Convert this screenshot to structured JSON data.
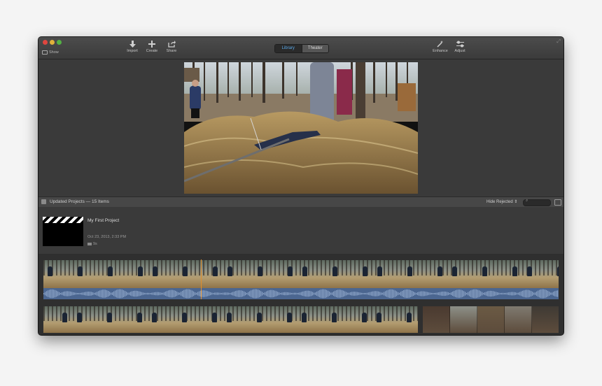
{
  "window": {
    "controls": [
      "close",
      "minimize",
      "zoom"
    ]
  },
  "toolbar": {
    "show_label": "Show",
    "import_label": "Import",
    "create_label": "Create",
    "share_label": "Share",
    "library_label": "Library",
    "theater_label": "Theater",
    "enhance_label": "Enhance",
    "adjust_label": "Adjust"
  },
  "browser": {
    "title": "Updated Projects — 15 Items",
    "hide_rejected_label": "Hide Rejected",
    "search_placeholder": ""
  },
  "project": {
    "name": "My First Project",
    "date": "Oct 23, 2013, 2:33 PM",
    "duration": "9s"
  },
  "icons": [
    "close-icon",
    "minimize-icon",
    "zoom-icon",
    "sidebar-icon",
    "import-arrow-icon",
    "create-plus-icon",
    "share-icon",
    "enhance-wand-icon",
    "adjust-sliders-icon",
    "fullscreen-icon",
    "search-icon",
    "filmstrip-icon"
  ],
  "colors": {
    "accent": "#5aa7e6",
    "audio_waveform": "#4b6690",
    "playhead": "#e08e2c"
  }
}
